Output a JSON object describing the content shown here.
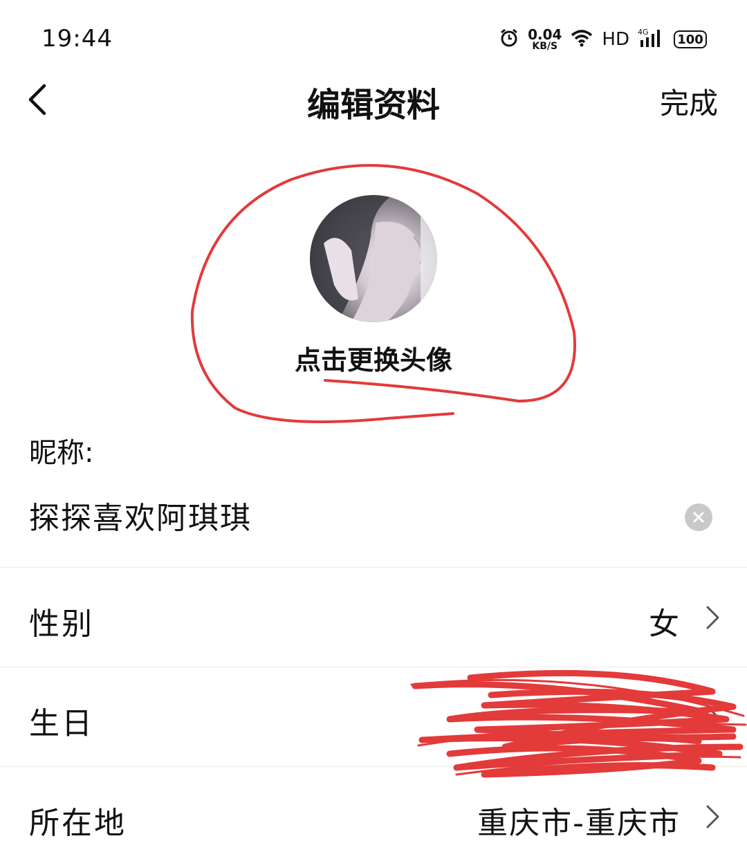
{
  "status_bar": {
    "time": "19:44",
    "net_speed": "0.04",
    "net_unit": "KB/S",
    "hd": "HD",
    "network": "4G",
    "battery": "100"
  },
  "nav": {
    "title": "编辑资料",
    "done_label": "完成"
  },
  "avatar": {
    "change_label": "点击更换头像"
  },
  "nickname": {
    "label": "昵称:",
    "value": "探探喜欢阿琪琪"
  },
  "rows": {
    "gender": {
      "label": "性别",
      "value": "女"
    },
    "birthday": {
      "label": "生日",
      "value": ""
    },
    "location": {
      "label": "所在地",
      "value": "重庆市-重庆市"
    }
  },
  "colors": {
    "annotation_red": "#e33a3a",
    "divider": "#ebebeb",
    "clear_button": "#c9c9c9"
  }
}
